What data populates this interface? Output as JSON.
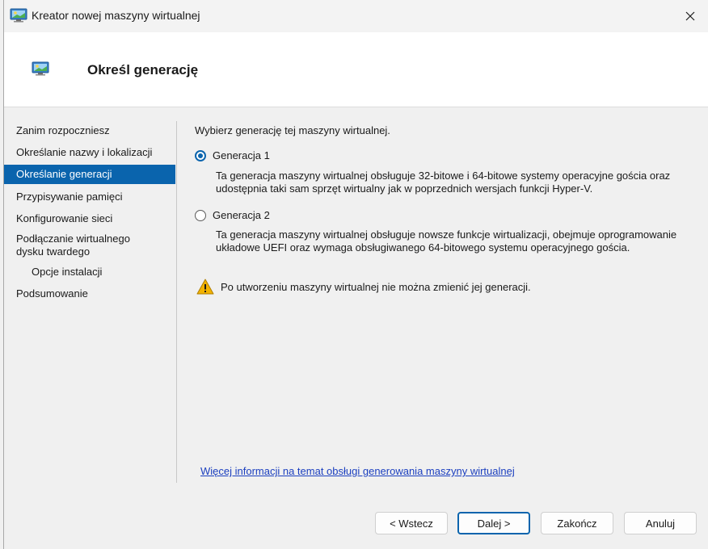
{
  "window": {
    "title": "Kreator nowej maszyny wirtualnej"
  },
  "header": {
    "title": "Określ generację"
  },
  "nav": {
    "items": [
      {
        "label": "Zanim rozpoczniesz"
      },
      {
        "label": "Określanie nazwy i lokalizacji"
      },
      {
        "label": "Określanie generacji",
        "selected": true
      },
      {
        "label": "Przypisywanie pamięci"
      },
      {
        "label": "Konfigurowanie sieci"
      },
      {
        "label": "Podłączanie wirtualnego\ndysku twardego"
      },
      {
        "label": "Opcje instalacji"
      },
      {
        "label": "Podsumowanie"
      }
    ]
  },
  "content": {
    "intro": "Wybierz generację tej maszyny wirtualnej.",
    "gen1": {
      "label": "Generacja 1",
      "checked": true,
      "description": "Ta generacja maszyny wirtualnej obsługuje 32-bitowe i 64-bitowe systemy operacyjne gościa oraz udostępnia taki sam sprzęt wirtualny jak w poprzednich wersjach funkcji Hyper-V."
    },
    "gen2": {
      "label": "Generacja 2",
      "checked": false,
      "description": "Ta generacja maszyny wirtualnej obsługuje nowsze funkcje wirtualizacji, obejmuje oprogramowanie układowe UEFI oraz wymaga obsługiwanego 64-bitowego systemu operacyjnego gościa."
    },
    "warning": "Po utworzeniu maszyny wirtualnej nie można zmienić jej generacji.",
    "more_link": "Więcej informacji na temat obsługi generowania maszyny wirtualnej"
  },
  "buttons": {
    "back": "< Wstecz",
    "next": "Dalej >",
    "finish": "Zakończ",
    "cancel": "Anuluj"
  },
  "colors": {
    "accent": "#0a64ad",
    "link": "#1b3fbf",
    "warning": "#f2b200"
  }
}
